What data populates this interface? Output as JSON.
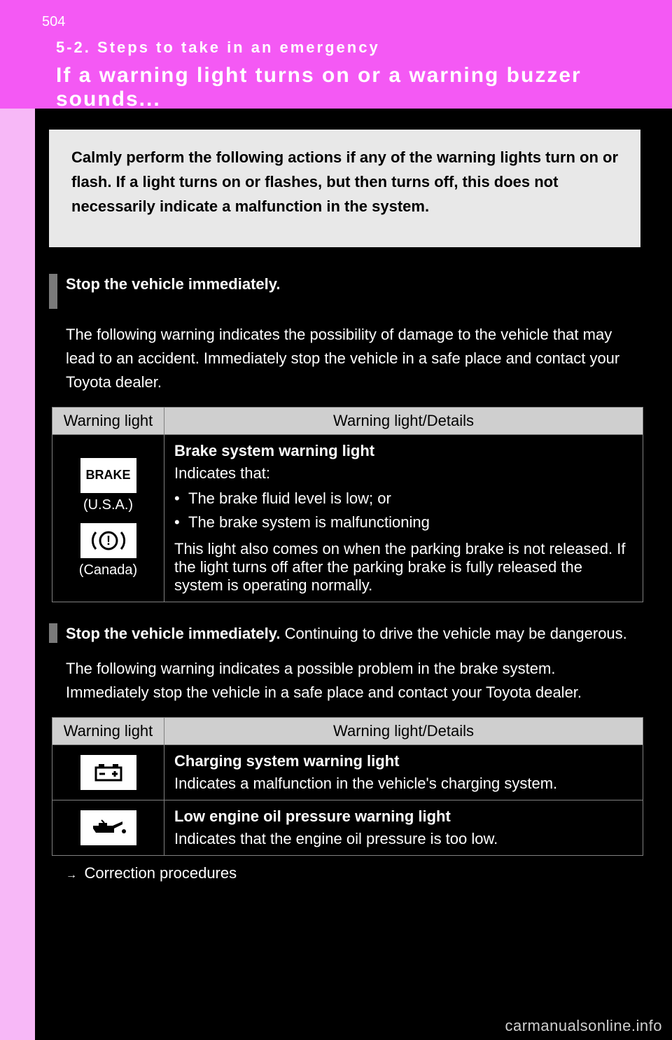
{
  "page_number": "504",
  "section_number": "5-2. Steps to take in an emergency",
  "page_title": "If a warning light turns on or a warning buzzer sounds...",
  "intro": "Calmly perform the following actions if any of the warning lights turn on or flash. If a light turns on or flashes, but then turns off, this does not necessarily indicate a malfunction in the system.",
  "block1": {
    "heading": "Stop the vehicle immediately.",
    "body": "The following warning indicates the possibility of damage to the vehicle that may lead to an accident. Immediately stop the vehicle in a safe place and contact your Toyota dealer.",
    "col_icon": "Warning light",
    "col_details": "Warning light/Details",
    "icon_brake": "BRAKE",
    "variant_us": "(U.S.A.)",
    "variant_ca": "(Canada)",
    "detail_title": "Brake system warning light",
    "detail_sub": "Indicates that:",
    "bullets": [
      "The brake fluid level is low; or",
      "The brake system is malfunctioning"
    ],
    "detail_note": "This light also comes on when the parking brake is not released. If the light turns off after the parking brake is fully released the system is operating normally."
  },
  "block2": {
    "heading": "Stop the vehicle immediately.",
    "body": "Continuing to drive the vehicle may be dangerous.",
    "lead": "The following warning indicates a possible problem in the brake system. Immediately stop the vehicle in a safe place and contact your Toyota dealer.",
    "col_icon": "Warning light",
    "col_details": "Warning light/Details",
    "row1_title": "Charging system warning light",
    "row1_body": "Indicates a malfunction in the vehicle's charging system.",
    "row2_title": "Low engine oil pressure warning light",
    "row2_body": "Indicates that the engine oil pressure is too low."
  },
  "correct": {
    "arrow": "→",
    "text": "Correction procedures"
  },
  "watermark": "carmanualsonline.info"
}
